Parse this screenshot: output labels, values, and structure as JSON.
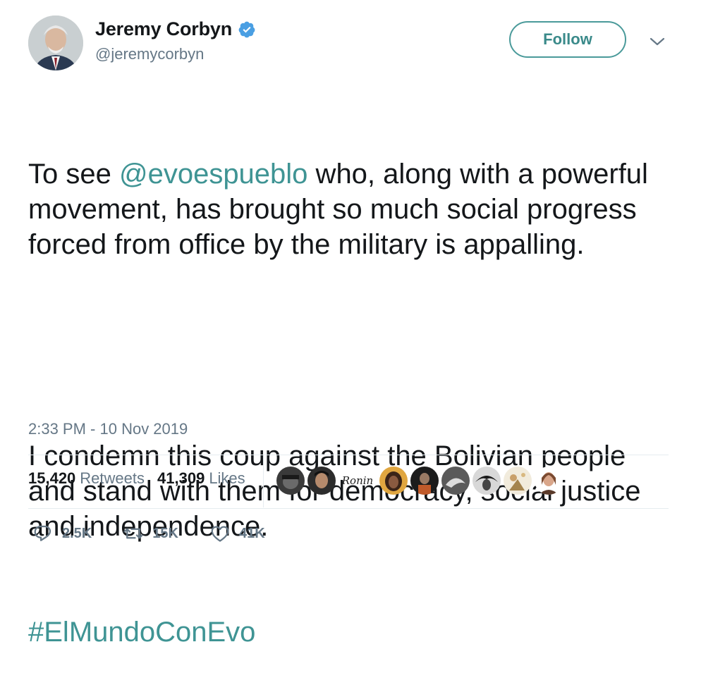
{
  "author": {
    "name": "Jeremy Corbyn",
    "handle": "@jeremycorbyn",
    "verified_icon": "verified-badge-icon"
  },
  "follow_label": "Follow",
  "tweet": {
    "p1_before": "To see ",
    "mention": "@evoespueblo",
    "p1_after": " who, along with a powerful movement, has brought so much social progress forced from office by the military is appalling.",
    "p2": "I condemn this coup against the Bolivian people and stand with them for democracy, social justice and independence.",
    "hashtag": "#ElMundoConEvo",
    "link_color": "#3f9494"
  },
  "timestamp": "2:33 PM - 10 Nov 2019",
  "stats": {
    "retweets_count": "15,420",
    "retweets_label": "Retweets",
    "likes_count": "41,309",
    "likes_label": "Likes"
  },
  "liker_text_avatar": "Ronin",
  "actions": {
    "replies": "2.5K",
    "retweets": "15K",
    "likes": "41K"
  }
}
